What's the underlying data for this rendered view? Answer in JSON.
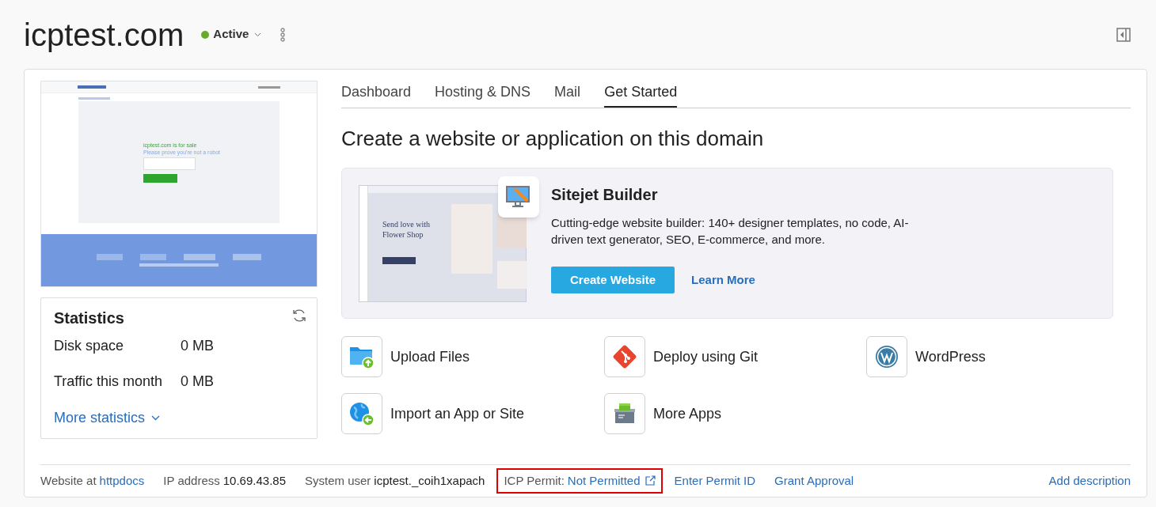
{
  "domain": {
    "title": "icptest.com",
    "status": {
      "label": "Active",
      "color": "#6aaa2a"
    }
  },
  "preview": {
    "sale_text": "icptest.com is for sale",
    "robot_text": "Please prove you're not a robot"
  },
  "statistics": {
    "title": "Statistics",
    "rows": [
      {
        "label": "Disk space",
        "value": "0 MB"
      },
      {
        "label": "Traffic this month",
        "value": "0 MB"
      }
    ],
    "more": "More statistics"
  },
  "tabs": [
    {
      "label": "Dashboard",
      "selected": false
    },
    {
      "label": "Hosting & DNS",
      "selected": false
    },
    {
      "label": "Mail",
      "selected": false
    },
    {
      "label": "Get Started",
      "selected": true
    }
  ],
  "heading": "Create a website or application on this domain",
  "sitejet": {
    "image_headline": "Send love with Flower Shop",
    "title": "Sitejet Builder",
    "description": "Cutting-edge website builder: 140+ designer templates, no code, AI-driven text generator, SEO, E-commerce, and more.",
    "primary_button": "Create Website",
    "link": "Learn More"
  },
  "actions": [
    {
      "kind": "upload",
      "label": "Upload Files"
    },
    {
      "kind": "git",
      "label": "Deploy using Git"
    },
    {
      "kind": "wordpress",
      "label": "WordPress"
    },
    {
      "kind": "import",
      "label": "Import an App or Site"
    },
    {
      "kind": "apps",
      "label": "More Apps"
    }
  ],
  "footer": [
    {
      "kind": "link",
      "label": "Website at",
      "value": "httpdocs",
      "highlighted": false
    },
    {
      "kind": "text",
      "label": "IP address",
      "value": "10.69.43.85",
      "highlighted": false
    },
    {
      "kind": "text",
      "label": "System user",
      "value": "icptest._coih1xapach",
      "highlighted": false
    },
    {
      "kind": "external",
      "label": "ICP Permit:",
      "value": "Not Permitted",
      "highlighted": true
    },
    {
      "kind": "action",
      "label": "Enter Permit ID",
      "highlighted": false
    },
    {
      "kind": "action",
      "label": "Grant Approval",
      "highlighted": false
    }
  ],
  "add_description": "Add description"
}
